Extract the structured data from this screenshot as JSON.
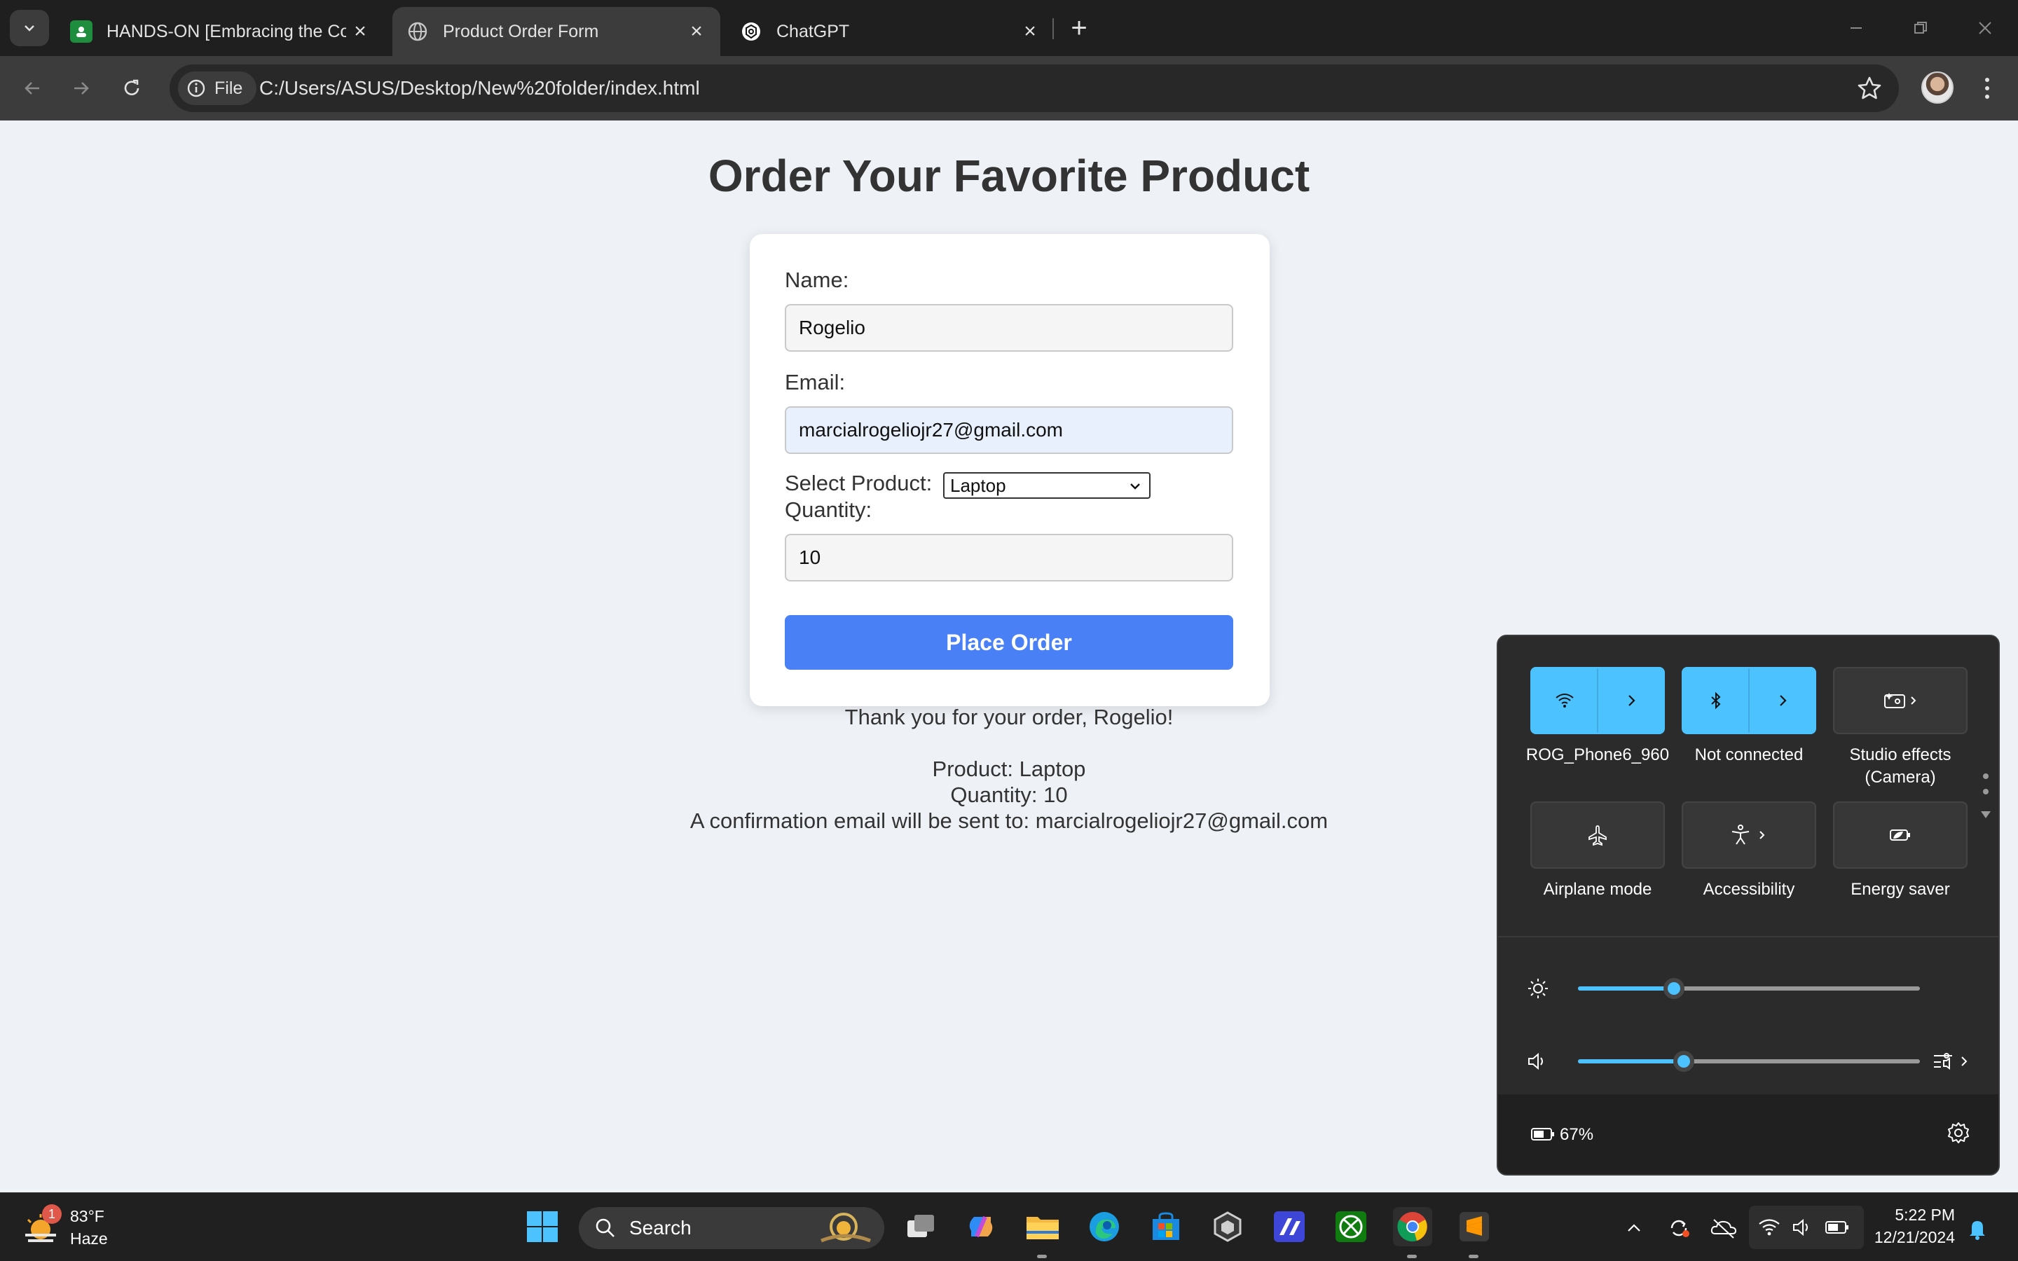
{
  "browser": {
    "tabs": [
      {
        "title": "HANDS-ON [Embracing the Co",
        "active": false
      },
      {
        "title": "Product Order Form",
        "active": true
      },
      {
        "title": "ChatGPT",
        "active": false
      }
    ],
    "site_chip": "File",
    "url": "C:/Users/ASUS/Desktop/New%20folder/index.html"
  },
  "page": {
    "heading": "Order Your Favorite Product",
    "form": {
      "name_label": "Name:",
      "name_value": "Rogelio",
      "email_label": "Email:",
      "email_value": "marcialrogeliojr27@gmail.com",
      "product_label": "Select Product:",
      "product_value": "Laptop",
      "quantity_label": "Quantity:",
      "quantity_value": "10",
      "submit_label": "Place Order"
    },
    "confirmation": {
      "thanks": "Thank you for your order, Rogelio!",
      "product": "Product: Laptop",
      "quantity": "Quantity: 10",
      "email_note": "A confirmation email will be sent to: marcialrogeliojr27@gmail.com"
    }
  },
  "quick_settings": {
    "tiles": [
      {
        "label": "ROG_Phone6_960",
        "icon": "wifi-icon",
        "on": true
      },
      {
        "label": "Not connected",
        "icon": "bluetooth-icon",
        "on": true
      },
      {
        "label": "Studio effects (Camera)",
        "label_line1": "Studio effects",
        "label_line2": "(Camera)",
        "icon": "studio-effects-icon",
        "on": false
      },
      {
        "label": "Airplane mode",
        "icon": "airplane-icon",
        "on": false
      },
      {
        "label": "Accessibility",
        "icon": "accessibility-icon",
        "on": false
      },
      {
        "label": "Energy saver",
        "icon": "energy-saver-icon",
        "on": false
      }
    ],
    "brightness_level": 0.28,
    "volume_level": 0.31,
    "battery": "67%",
    "accent_color": "#4cc2ff"
  },
  "taskbar": {
    "weather_temp": "83°F",
    "weather_condition": "Haze",
    "weather_badge": "1",
    "search_placeholder": "Search",
    "time": "5:22 PM",
    "date": "12/21/2024"
  }
}
